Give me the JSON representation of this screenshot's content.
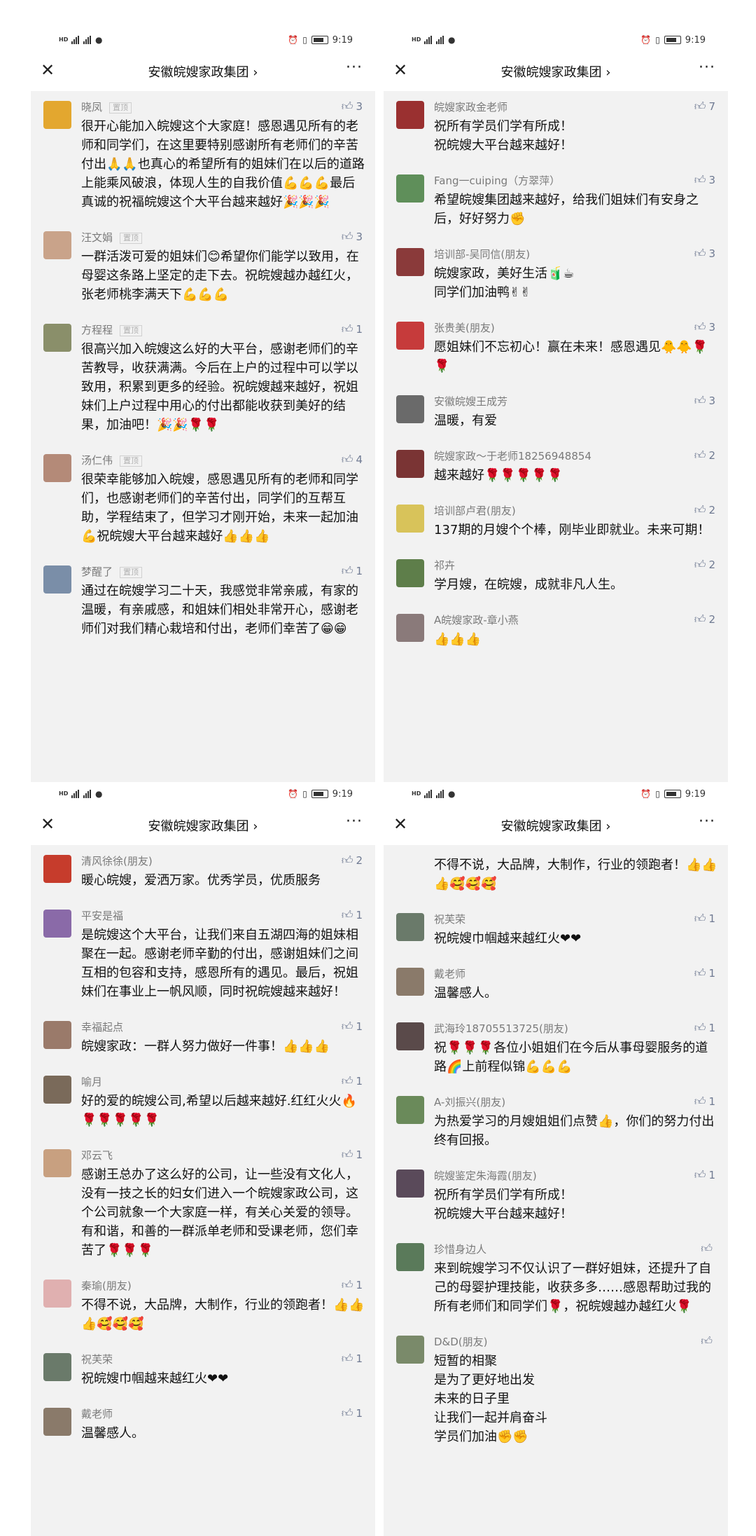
{
  "status_bar": {
    "network": "HD",
    "time": "9:19"
  },
  "header": {
    "title": "安徽皖嫂家政集团 ›",
    "close_icon": "close-icon",
    "more_icon": "more-icon",
    "more_glyph": "···",
    "close_glyph": "✕"
  },
  "like_icon": "thumb-up-icon",
  "pin_label": "置顶",
  "panels": [
    {
      "comments": [
        {
          "name": "晓凤",
          "pinned": true,
          "likes": "3",
          "avatar_color": "#e3a72f",
          "text": "很开心能加入皖嫂这个大家庭！感恩遇见所有的老师和同学们，在这里要特别感谢所有老师们的辛苦付出🙏🙏也真心的希望所有的姐妹们在以后的道路上能乘风破浪，体现人生的自我价值💪💪💪最后真诚的祝福皖嫂这个大平台越来越好🎉🎉🎉"
        },
        {
          "name": "汪文娟",
          "pinned": true,
          "likes": "3",
          "avatar_color": "#c9a38a",
          "text": "一群活泼可爱的姐妹们😊希望你们能学以致用，在母婴这条路上坚定的走下去。祝皖嫂越办越红火，张老师桃李满天下💪💪💪"
        },
        {
          "name": "方程程",
          "pinned": true,
          "likes": "1",
          "avatar_color": "#8a8f6a",
          "text": "很高兴加入皖嫂这么好的大平台，感谢老师们的辛苦教导，收获满满。今后在上户的过程中可以学以致用，积累到更多的经验。祝皖嫂越来越好，祝姐妹们上户过程中用心的付出都能收获到美好的结果，加油吧！🎉🎉🌹🌹"
        },
        {
          "name": "汤仁伟",
          "pinned": true,
          "likes": "4",
          "avatar_color": "#b48a78",
          "text": "很荣幸能够加入皖嫂，感恩遇见所有的老师和同学们，也感谢老师们的辛苦付出，同学们的互帮互助，学程结束了，但学习才刚开始，未来一起加油💪祝皖嫂大平台越来越好👍👍👍"
        },
        {
          "name": "梦醒了",
          "pinned": true,
          "likes": "1",
          "avatar_color": "#7a8ea8",
          "text": "通过在皖嫂学习二十天，我感觉非常亲戚，有家的温暖，有亲戚感，和姐妹们相处非常开心，感谢老师们对我们精心栽培和付出，老师们幸苦了😁😁"
        }
      ]
    },
    {
      "comments": [
        {
          "name": "皖嫂家政金老师",
          "pinned": false,
          "likes": "7",
          "avatar_color": "#9a3030",
          "text": "祝所有学员们学有所成！\n祝皖嫂大平台越来越好！"
        },
        {
          "name": "Fang一cuiping（方翠萍）",
          "pinned": false,
          "likes": "3",
          "avatar_color": "#5f8f5a",
          "text": "希望皖嫂集团越来越好，给我们姐妹们有安身之后，好好努力✊"
        },
        {
          "name": "培训部-吴同信(朋友)",
          "pinned": false,
          "likes": "3",
          "avatar_color": "#8a3a3a",
          "text": "皖嫂家政，美好生活🧃☕\n同学们加油鸭✌✌"
        },
        {
          "name": "张贵美(朋友)",
          "pinned": false,
          "likes": "3",
          "avatar_color": "#c63b3b",
          "text": "愿姐妹们不忘初心！赢在未来！感恩遇见🐥🐥🌹🌹"
        },
        {
          "name": "安徽皖嫂王成芳",
          "pinned": false,
          "likes": "3",
          "avatar_color": "#6a6a6a",
          "text": "温暖，有爱"
        },
        {
          "name": "皖嫂家政～于老师18256948854",
          "pinned": false,
          "likes": "2",
          "avatar_color": "#7a3434",
          "text": "越来越好🌹🌹🌹🌹🌹"
        },
        {
          "name": "培训部卢君(朋友)",
          "pinned": false,
          "likes": "2",
          "avatar_color": "#d8c35a",
          "text": "137期的月嫂个个棒，刚毕业即就业。未来可期！"
        },
        {
          "name": "祁卉",
          "pinned": false,
          "likes": "2",
          "avatar_color": "#5e7e4a",
          "text": "学月嫂，在皖嫂，成就非凡人生。"
        },
        {
          "name": "A皖嫂家政-章小燕",
          "pinned": false,
          "likes": "2",
          "avatar_color": "#8a7a7a",
          "text": "👍👍👍"
        }
      ]
    },
    {
      "comments": [
        {
          "name": "清风徐徐(朋友)",
          "pinned": false,
          "likes": "2",
          "avatar_color": "#c63c2c",
          "text": "暖心皖嫂，爱洒万家。优秀学员，优质服务"
        },
        {
          "name": "平安是福",
          "pinned": false,
          "likes": "1",
          "avatar_color": "#8a6aa8",
          "text": "是皖嫂这个大平台，让我们来自五湖四海的姐妹相聚在一起。感谢老师辛勤的付出，感谢姐妹们之间互相的包容和支持，感恩所有的遇见。最后，祝姐妹们在事业上一帆风顺，同时祝皖嫂越来越好！"
        },
        {
          "name": "幸福起点",
          "pinned": false,
          "likes": "1",
          "avatar_color": "#9a7a6a",
          "text": "皖嫂家政：一群人努力做好一件事！👍👍👍"
        },
        {
          "name": "喻月",
          "pinned": false,
          "likes": "1",
          "avatar_color": "#7a6a5a",
          "text": "好的爱的皖嫂公司,希望以后越来越好.红红火火🔥🌹🌹🌹🌹🌹"
        },
        {
          "name": "邓云飞",
          "pinned": false,
          "likes": "1",
          "avatar_color": "#c8a080",
          "text": "感谢王总办了这么好的公司，让一些没有文化人，没有一技之长的妇女们进入一个皖嫂家政公司，这个公司就象一个大家庭一样，有关心关爱的领导。有和谐，和善的一群派单老师和受课老师，您们幸苦了🌹🌹🌹"
        },
        {
          "name": "秦瑜(朋友)",
          "pinned": false,
          "likes": "1",
          "avatar_color": "#e0b0b0",
          "text": "不得不说，大品牌，大制作，行业的领跑者！👍👍👍🥰🥰🥰"
        },
        {
          "name": "祝芙荣",
          "pinned": false,
          "likes": "1",
          "avatar_color": "#6a7a6a",
          "text": "祝皖嫂巾帼越来越红火❤❤"
        },
        {
          "name": "戴老师",
          "pinned": false,
          "likes": "1",
          "avatar_color": "#8a7a6a",
          "text": "温馨感人。"
        }
      ]
    },
    {
      "comments": [
        {
          "name": "",
          "pinned": false,
          "likes": "",
          "avatar_color": "",
          "text": "不得不说，大品牌，大制作，行业的领跑者！👍👍👍🥰🥰🥰"
        },
        {
          "name": "祝芙荣",
          "pinned": false,
          "likes": "1",
          "avatar_color": "#6a7a6a",
          "text": "祝皖嫂巾帼越来越红火❤❤"
        },
        {
          "name": "戴老师",
          "pinned": false,
          "likes": "1",
          "avatar_color": "#8a7a6a",
          "text": "温馨感人。"
        },
        {
          "name": "武海玲18705513725(朋友)",
          "pinned": false,
          "likes": "1",
          "avatar_color": "#5a4a4a",
          "text": "祝🌹🌹🌹各位小姐姐们在今后从事母婴服务的道路🌈上前程似锦💪💪💪"
        },
        {
          "name": "A-刘振兴(朋友)",
          "pinned": false,
          "likes": "1",
          "avatar_color": "#6a8a5a",
          "text": "为热爱学习的月嫂姐姐们点赞👍，你们的努力付出终有回报。"
        },
        {
          "name": "皖嫂鉴定朱海霞(朋友)",
          "pinned": false,
          "likes": "1",
          "avatar_color": "#5a4a5a",
          "text": "祝所有学员们学有所成！\n祝皖嫂大平台越来越好！"
        },
        {
          "name": "珍惜身边人",
          "pinned": false,
          "likes": "",
          "avatar_color": "#5a7a5a",
          "text": "来到皖嫂学习不仅认识了一群好姐妹，还提升了自己的母婴护理技能，收获多多……感恩帮助过我的所有老师们和同学们🌹，祝皖嫂越办越红火🌹"
        },
        {
          "name": "D&D(朋友)",
          "pinned": false,
          "likes": "",
          "avatar_color": "#7a8a6a",
          "text": "短暂的相聚\n是为了更好地出发\n未来的日子里\n让我们一起并肩奋斗\n学员们加油✊✊"
        }
      ]
    }
  ]
}
